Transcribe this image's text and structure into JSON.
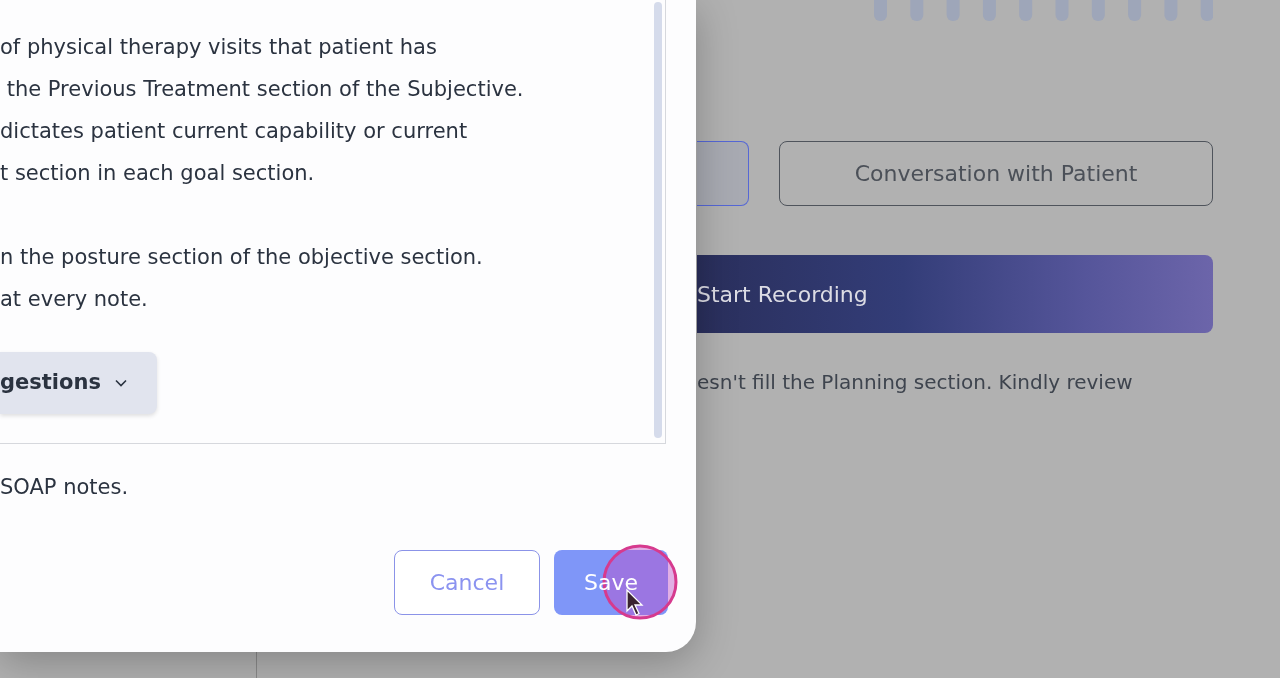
{
  "background": {
    "tabs": [
      {
        "selected": true
      },
      {
        "label": "Conversation with Patient",
        "selected": false
      }
    ],
    "record_button": {
      "label": "Start Recording"
    },
    "notice": "esn't fill the Planning section. Kindly review"
  },
  "modal": {
    "paragraphs": [
      [
        "of physical therapy visits that patient has",
        " the Previous Treatment section of the Subjective.",
        "dictates patient current capability or current",
        "t section in each goal section."
      ],
      [
        "n the posture section of the objective section.",
        "at every note."
      ]
    ],
    "suggestions_button": {
      "label": "gestions"
    },
    "footer_text": "SOAP notes.",
    "buttons": [
      {
        "label": "Cancel",
        "kind": "secondary"
      },
      {
        "label": "Save",
        "kind": "primary"
      }
    ]
  }
}
